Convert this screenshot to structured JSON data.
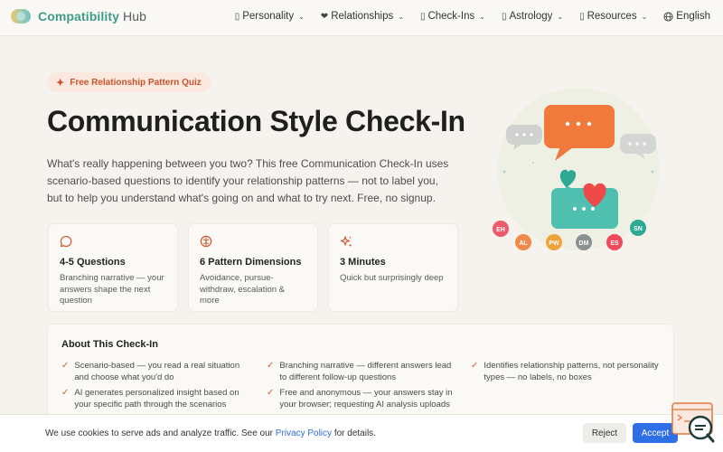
{
  "brand": {
    "part1": "Compatibility",
    "part2": "Hub"
  },
  "nav": {
    "items": [
      {
        "label": "Personality",
        "icon": "missing-glyph",
        "has_caret": true
      },
      {
        "label": "Relationships",
        "icon": "heart-icon",
        "has_caret": true
      },
      {
        "label": "Check-Ins",
        "icon": "missing-glyph",
        "has_caret": true
      },
      {
        "label": "Astrology",
        "icon": "missing-glyph",
        "has_caret": true
      },
      {
        "label": "Resources",
        "icon": "missing-glyph",
        "has_caret": true
      }
    ],
    "language": "English"
  },
  "hero": {
    "badge": "Free Relationship Pattern Quiz",
    "title": "Communication Style Check-In",
    "intro": "What's really happening between you two? This free Communication Check-In uses scenario-based questions to identify your relationship patterns — not to label you, but to help you understand what's going on and what to try next. Free, no signup."
  },
  "features": [
    {
      "icon": "chat-bubble-icon",
      "title": "4-5 Questions",
      "desc": "Branching narrative — your answers shape the next question"
    },
    {
      "icon": "brain-icon",
      "title": "6 Pattern Dimensions",
      "desc": "Avoidance, pursue-withdraw, escalation & more"
    },
    {
      "icon": "sparkles-icon",
      "title": "3 Minutes",
      "desc": "Quick but surprisingly deep"
    }
  ],
  "illustration": {
    "avatars": [
      "EH",
      "AL",
      "PW",
      "DM",
      "ES",
      "SN"
    ]
  },
  "about": {
    "heading": "About This Check-In",
    "items": [
      "Scenario-based — you read a real situation and choose what you'd do",
      "Branching narrative — different answers lead to different follow-up questions",
      "Identifies relationship patterns, not personality types — no labels, no boxes",
      "AI generates personalized insight based on your specific path through the scenarios",
      "Free and anonymous — your answers stay in your browser; requesting AI analysis uploads"
    ]
  },
  "cookie": {
    "text_before": "We use cookies to serve ads and analyze traffic. See our",
    "link": "Privacy Policy",
    "text_after": "for details.",
    "reject": "Reject",
    "accept": "Accept"
  },
  "colors": {
    "accent": "#d35e34",
    "brand_teal": "#3f9c8a",
    "brand_orange": "#e09a3c",
    "accept_blue": "#2f6fe6"
  }
}
